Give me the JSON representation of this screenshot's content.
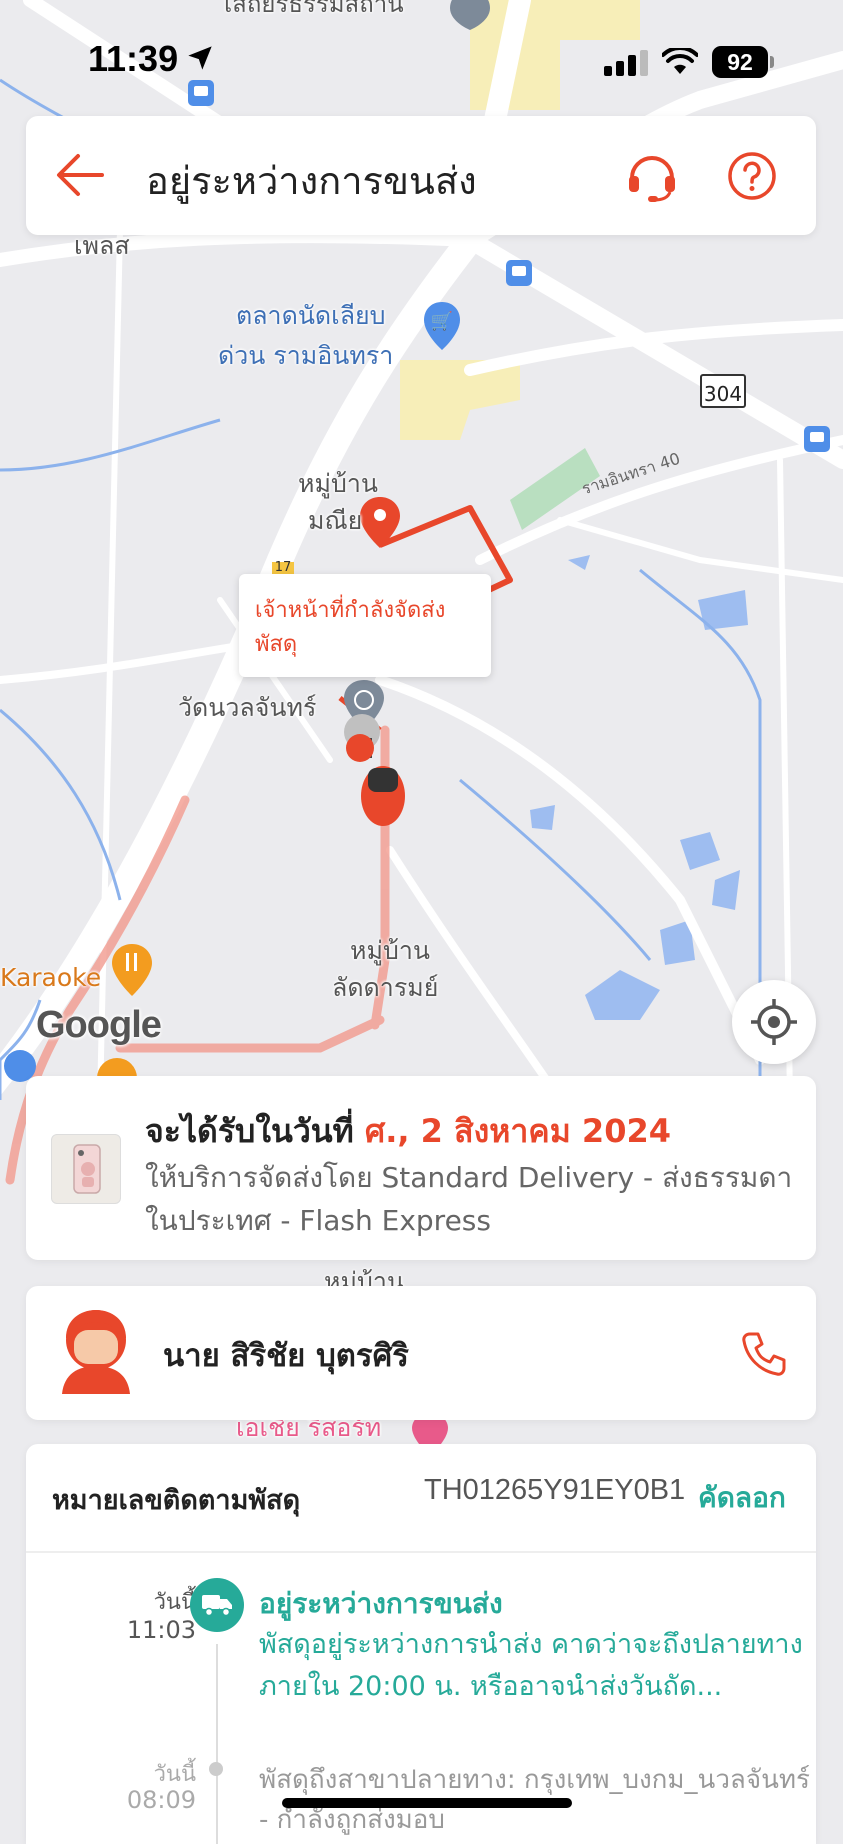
{
  "status_bar": {
    "time": "11:39",
    "battery": "92"
  },
  "header": {
    "title": "อยู่ระหว่างการขนส่ง",
    "back_icon": "arrow-left-icon",
    "support_icon": "headset-icon",
    "help_icon": "question-circle-icon",
    "accent_color": "#e8472b"
  },
  "map": {
    "labels": {
      "top_temple": "เสถียรธรรมสถาน",
      "pelus": "เพลส",
      "market_line1": "ตลาดนัดเลียบ",
      "market_line2": "ด่วน รามอินทรา",
      "road_304": "304",
      "village_manee_line1": "หมู่บ้าน",
      "village_manee_line2": "มณีย",
      "ram_road": "รามอินทรา 40",
      "wat_nuan": "วัดนวลจันทร์",
      "village_ladda_line1": "หมู่บ้าน",
      "village_ladda_line2": "ลัดดารมย์",
      "karaoke": "Karaoke",
      "google": "Google",
      "road_17": "17",
      "village_bottom": "หมู่บ้าน",
      "resort": "เอเชีย รีสอร์ท"
    },
    "tooltip": "เจ้าหน้าที่กำลังจัดส่งพัสดุ",
    "recenter_icon": "crosshair-icon"
  },
  "delivery": {
    "prefix": "จะได้รับในวันที่ ",
    "date": "ศ., 2 สิงหาคม 2024",
    "service": "ให้บริการจัดส่งโดย Standard Delivery - ส่งธรรมดาในประเทศ - Flash Express"
  },
  "courier": {
    "name": "นาย สิริชัย บุตรศิริ",
    "phone_icon": "phone-icon"
  },
  "tracking": {
    "label": "หมายเลขติดตามพัสดุ",
    "number": "TH01265Y91EY0B1",
    "copy": "คัดลอก",
    "events": [
      {
        "day": "วันนี้",
        "time": "11:03",
        "title": "อยู่ระหว่างการขนส่ง",
        "description": "พัสดุอยู่ระหว่างการนำส่ง คาดว่าจะถึงปลายทางภายใน 20:00 น. หรืออาจนำส่งวันถัด..."
      },
      {
        "day": "วันนี้",
        "time": "08:09",
        "description": "พัสดุถึงสาขาปลายทาง: กรุงเทพ_บงกม_นวลจันทร์ - กำลังถูกส่งมอบ"
      }
    ],
    "accent_color": "#26aa99"
  }
}
